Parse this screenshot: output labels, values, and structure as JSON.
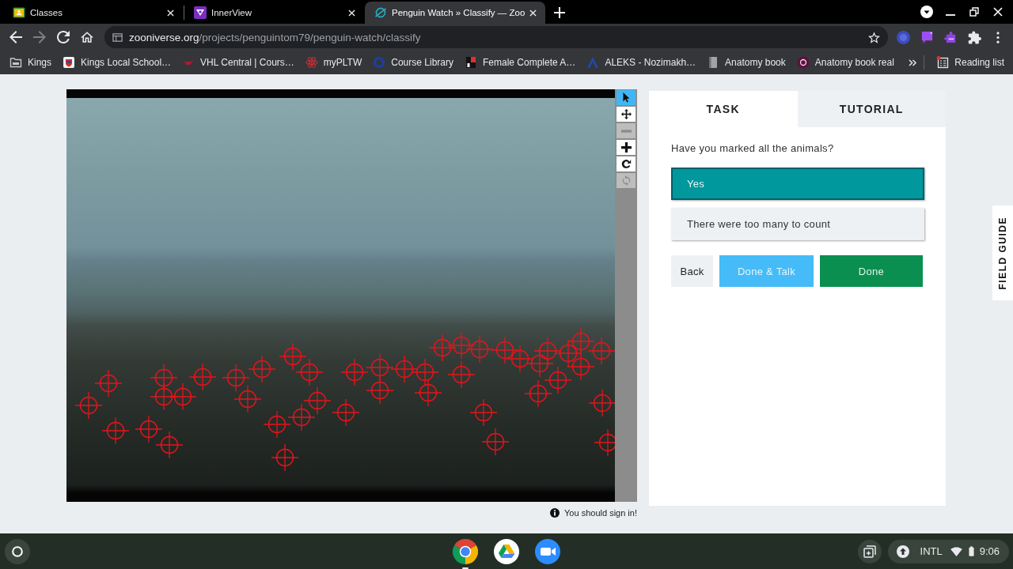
{
  "browser": {
    "tabs": [
      {
        "title": "Classes",
        "selected": false
      },
      {
        "title": "InnerView",
        "selected": false
      },
      {
        "title": "Penguin Watch » Classify — Zoo",
        "selected": true
      }
    ],
    "nav_buttons": [
      {
        "kind": "back",
        "disabled": false
      },
      {
        "kind": "forward",
        "disabled": true
      },
      {
        "kind": "reload",
        "disabled": false
      },
      {
        "kind": "home",
        "disabled": false
      }
    ],
    "address": {
      "host": "zooniverse.org",
      "path": "/projects/penguintom79/penguin-watch/classify"
    },
    "bookmarks": [
      {
        "label": "Kings"
      },
      {
        "label": "Kings Local School…"
      },
      {
        "label": "VHL Central | Cours…"
      },
      {
        "label": "myPLTW"
      },
      {
        "label": "Course Library"
      },
      {
        "label": "Female Complete A…"
      },
      {
        "label": "ALEKS - Nozimakh…"
      },
      {
        "label": "Anatomy book"
      },
      {
        "label": "Anatomy book real"
      }
    ],
    "reading_list": "Reading list"
  },
  "classifier": {
    "tools": [
      {
        "kind": "select",
        "selected": true,
        "disabled": false
      },
      {
        "kind": "pan",
        "selected": false,
        "disabled": false
      },
      {
        "kind": "zoom_out",
        "selected": false,
        "disabled": true
      },
      {
        "kind": "zoom_in",
        "selected": false,
        "disabled": false
      },
      {
        "kind": "rotate",
        "selected": false,
        "disabled": false
      },
      {
        "kind": "reset",
        "selected": false,
        "disabled": true
      }
    ],
    "sign_in_note": "You should sign in!"
  },
  "task_panel": {
    "tabs": [
      {
        "label": "TASK",
        "selected": true
      },
      {
        "label": "TUTORIAL",
        "selected": false
      }
    ],
    "question": "Have you marked all the animals?",
    "answers": [
      {
        "label": "Yes",
        "selected": true
      },
      {
        "label": "There were too many to count",
        "selected": false
      }
    ],
    "actions": [
      {
        "label": "Back",
        "kind": "back"
      },
      {
        "label": "Done & Talk",
        "kind": "talk"
      },
      {
        "label": "Done",
        "kind": "done"
      }
    ]
  },
  "field_guide": {
    "label": "FIELD GUIDE"
  },
  "shelf": {
    "apps": [
      {
        "running": true
      },
      {
        "running": false
      },
      {
        "running": false
      }
    ],
    "input_method": "INTL",
    "time": "9:06"
  }
}
